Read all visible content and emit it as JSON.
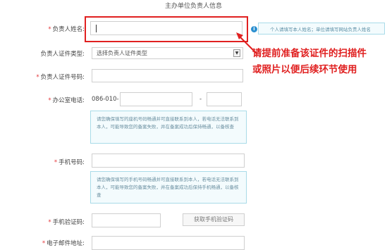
{
  "page": {
    "title": "主办单位负责人信息"
  },
  "form": {
    "name_label": "负责人姓名:",
    "name_hint": "个人请填写本人姓名；单位请填写网站负责人姓名",
    "info_icon": "info-icon",
    "id_type_label": "负责人证件类型:",
    "id_type_value": "选择负责人证件类型",
    "id_number_label": "负责人证件号码:",
    "office_phone_label": "办公室电话:",
    "office_phone_prefix": "086-010-",
    "office_phone_sep": "-",
    "office_phone_tip": "请您确保填写的座机号码畅通并可直接联系到本人，若电话无法联系到本人，可能导致您的备案失败，并在备案成功后保持畅通，以备核查",
    "mobile_label": "手机号码:",
    "mobile_tip": "请您确保填写的手机号码畅通并可直接联系到本人，若电话无法联系到本人，可能导致您的备案失败，并在备案成功后保持手机畅通，以备核查",
    "sms_label": "手机验证码:",
    "sms_button": "获取手机验证码",
    "email_label": "电子邮件地址:"
  },
  "annotation": {
    "line1": "请提前准备该证件的扫描件",
    "line2": "或照片以便后续环节使用",
    "color": "#e02020"
  }
}
